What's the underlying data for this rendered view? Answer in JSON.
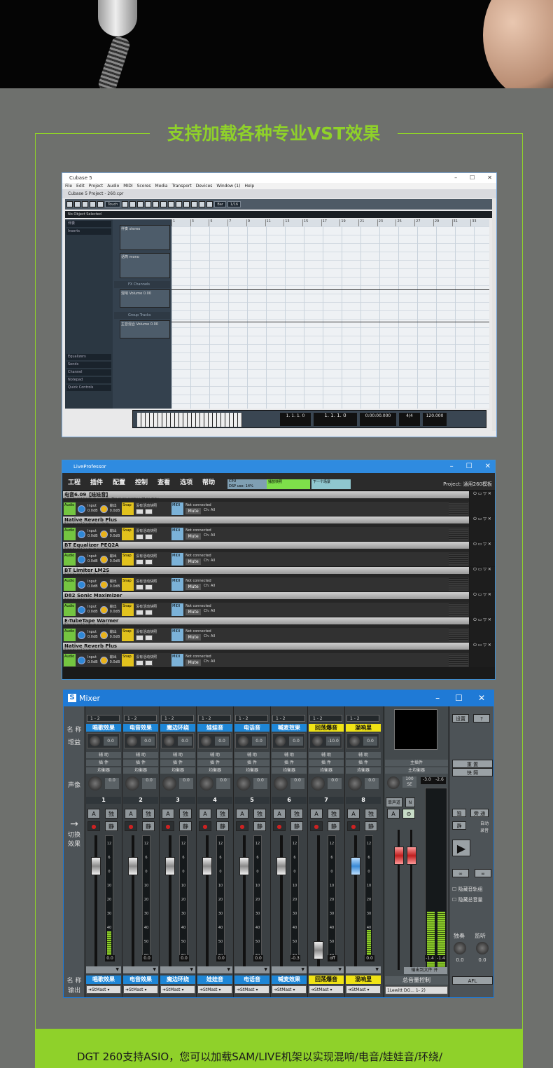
{
  "heading": "支持加载各种专业VST效果",
  "footer_text": "DGT  260支持ASIO，您可以加载SAM/LIVE机架以实现混响/电音/娃娃音/环绕/",
  "colors": {
    "accent_green": "#8fd12a",
    "page_bg": "#6e706d",
    "titlebar_blue": "#1f7ad6"
  },
  "cubase": {
    "window_title": "Cubase 5",
    "controls": [
      "–",
      "☐",
      "✕"
    ],
    "menu": [
      "File",
      "Edit",
      "Project",
      "Audio",
      "MIDI",
      "Scores",
      "Media",
      "Transport",
      "Devices",
      "Window (1)",
      "Help"
    ],
    "project_title": "Cubase 5 Project - 260.cpr",
    "touch_label": "Touch",
    "bar_label": "Bar",
    "grid_label": "1/16",
    "info_text": "No Object Selected",
    "inspector_title": "伴奏",
    "inspector_rows": [
      "Inserts",
      "Equalizers",
      "Sends",
      "Channel",
      "Notepad",
      "Quick Controls"
    ],
    "ruler": [
      "1",
      "3",
      "5",
      "7",
      "9",
      "11",
      "13",
      "15",
      "17",
      "19",
      "21",
      "23",
      "25",
      "27",
      "29",
      "31",
      "33"
    ],
    "tracks": [
      {
        "name": "伴奏",
        "sub": "stereo"
      },
      {
        "name": "话筒",
        "sub": "mono"
      }
    ],
    "folders": [
      "FX Channels",
      "Group Tracks"
    ],
    "fx_tracks": [
      {
        "name": "混响",
        "param": "Volume",
        "val": "0.00"
      },
      {
        "name": "主音混合",
        "param": "Volume",
        "val": "0.00"
      }
    ],
    "transport": {
      "position": "1. 1. 1.   0",
      "time": "0:00:00.000",
      "tempo": "120.000",
      "sig": "4/4",
      "pos_l": "1. 1. 1.   0",
      "pos_r": "1. 1. 1.   0"
    }
  },
  "liveprof": {
    "window_title": "LiveProfessor",
    "controls": [
      "–",
      "☐",
      "✕"
    ],
    "menu": [
      "工程",
      "插件",
      "配置",
      "控制",
      "查看",
      "选项",
      "帮助"
    ],
    "dsp": "CPU\nDSP use: 14%",
    "bar1": "播放快照",
    "bar2": "下一个场景",
    "project": "Project: 通用260模板",
    "plugins": [
      {
        "name": "电音6.09【娃娃音】",
        "sub": "2 inputs and 2 outputs available. This plugin creates a 29 ms delay"
      },
      {
        "name": "Native Reverb Plus",
        "sub": "2 inputs and 2 outputs available"
      },
      {
        "name": "BT Equalizer PEQ2A",
        "sub": "2 inputs and 2 outputs available"
      },
      {
        "name": "BT Limiter LM2S",
        "sub": "2 inputs and 2 outputs available"
      },
      {
        "name": "D82 Sonic Maximizer",
        "sub": "2 inputs and 2 outputs available"
      },
      {
        "name": "E-TubeTape Warmer",
        "sub": "2 inputs and 2 outputs available"
      },
      {
        "name": "Native Reverb Plus",
        "sub": "2 inputs and 2 outputs available"
      }
    ],
    "row": {
      "audio": "Audio",
      "input": "Input",
      "input_val": "0.0dB",
      "out": "输出",
      "out_val": "0.0dB",
      "snap": "Snap",
      "snap_txt": "没有活动快照",
      "midi": "MIDI",
      "midi_status": "Not connected",
      "mute": "Mute",
      "ch": "Ch: All"
    }
  },
  "mixer": {
    "window_title": "Mixer",
    "controls": [
      "–",
      "☐",
      "✕"
    ],
    "left_labels": [
      "名 称",
      "增益",
      "声像",
      "切换效果",
      "名 称",
      "输出"
    ],
    "channels": [
      {
        "num": "1",
        "name": "唱歌效果",
        "route": "1 - 2",
        "gain": "0.0",
        "pan": "0.0",
        "bottom": "唱歌效果",
        "out": "StMast",
        "val": "0.0",
        "hl": false
      },
      {
        "num": "2",
        "name": "电音效果",
        "route": "1 - 2",
        "gain": "0.0",
        "pan": "0.0",
        "bottom": "电音效果",
        "out": "StMast",
        "val": "0.0",
        "hl": false
      },
      {
        "num": "3",
        "name": "魔边环绕",
        "route": "1 - 2",
        "gain": "0.0",
        "pan": "0.0",
        "bottom": "魔边环绕",
        "out": "StMast",
        "val": "0.0",
        "hl": false
      },
      {
        "num": "4",
        "name": "娃娃音",
        "route": "1 - 2",
        "gain": "0.0",
        "pan": "0.0",
        "bottom": "娃娃音",
        "out": "StMast",
        "val": "0.0",
        "hl": false
      },
      {
        "num": "5",
        "name": "电话音",
        "route": "1 - 2",
        "gain": "0.0",
        "pan": "0.0",
        "bottom": "电话音",
        "out": "StMast",
        "val": "0.0",
        "hl": false
      },
      {
        "num": "6",
        "name": "喊麦效果",
        "route": "1 - 2",
        "gain": "0.0",
        "pan": "0.0",
        "bottom": "喊麦效果",
        "out": "StMast",
        "val": "-0.3",
        "hl": false
      },
      {
        "num": "7",
        "name": "回荡爆音",
        "route": "1 - 2",
        "gain": "-10.0",
        "pan": "0.0",
        "bottom": "回荡爆音",
        "out": "StMast",
        "val": "off",
        "hl": true
      },
      {
        "num": "8",
        "name": "混响里",
        "route": "1 - 2",
        "gain": "0.0",
        "pan": "0.0",
        "bottom": "混响里",
        "out": "StMast",
        "val": "0.0",
        "hl": true
      }
    ],
    "aux_labels": [
      "辅 助",
      "插 件",
      "均衡器"
    ],
    "master": {
      "insert": "主插件",
      "eq": "主均衡器",
      "pan": "100",
      "se": "SE",
      "db_l": "-3.0",
      "db_r": "-2.6",
      "mono": "单声道",
      "n": "N",
      "val_l": "-1.4",
      "val_r": "-1.4",
      "dropdown": "输出到文件",
      "open": "开",
      "name": "总音量控制",
      "out": "1Lewitt DG... 1- 2)"
    },
    "right": {
      "settings": "设置",
      "help": "?",
      "reset": "重 置",
      "fast": "快 照",
      "solo": "独奏",
      "monitor": "监听",
      "hide_unused": "隐藏音轨组",
      "hide_all": "隐藏总音量",
      "auto": "自动",
      "rec": "录音",
      "solo_btn": "独",
      "bypass_btn": "旁 通",
      "mute_btn": "静",
      "afl": "AFL",
      "val_l": "0.0",
      "val_r": "0.0"
    },
    "buttons": {
      "a": "A",
      "solo": "独",
      "mute": "静"
    },
    "meter_scale": [
      "12",
      "6",
      "0",
      "10",
      "20",
      "30",
      "40",
      "50",
      "60"
    ]
  }
}
